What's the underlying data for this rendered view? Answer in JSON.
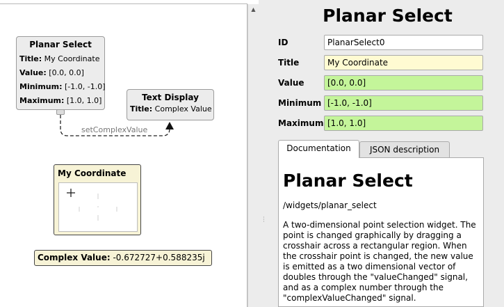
{
  "canvas": {
    "planar_node": {
      "title": "Planar Select",
      "rows": [
        {
          "key": "Title:",
          "value": "My Coordinate"
        },
        {
          "key": "Value:",
          "value": "[0.0,  0.0]"
        },
        {
          "key": "Minimum:",
          "value": "[-1.0,  -1.0]"
        },
        {
          "key": "Maximum:",
          "value": "[1.0,  1.0]"
        }
      ]
    },
    "text_node": {
      "title": "Text Display",
      "rows": [
        {
          "key": "Title:",
          "value": "Complex Value"
        }
      ]
    },
    "connection_label": "setComplexValue",
    "coord_widget": {
      "title": "My Coordinate",
      "crosshair": {
        "x": -0.672727,
        "y": 0.588235
      }
    },
    "complex_display": {
      "label": "Complex Value:",
      "value": "-0.672727+0.588235j"
    }
  },
  "panel": {
    "title": "Planar Select",
    "fields": [
      {
        "label": "ID",
        "value": "PlanarSelect0",
        "color": "#ffffff"
      },
      {
        "label": "Title",
        "value": "My Coordinate",
        "color": "#fffbd2"
      },
      {
        "label": "Value",
        "value": "[0.0, 0.0]",
        "color": "#c4f59a"
      },
      {
        "label": "Minimum",
        "value": "[-1.0, -1.0]",
        "color": "#c4f59a"
      },
      {
        "label": "Maximum",
        "value": "[1.0, 1.0]",
        "color": "#c4f59a"
      }
    ],
    "tabs": {
      "documentation": "Documentation",
      "json": "JSON description"
    },
    "doc": {
      "heading": "Planar Select",
      "path": "/widgets/planar_select",
      "body": "A two-dimensional point selection widget. The point is changed graphically by dragging a crosshair across a rectangular region. When the crosshair point is changed, the new value is emitted as a two dimensional vector of doubles through the \"valueChanged\" signal, and as a complex number through the \"complexValueChanged\" signal."
    }
  }
}
